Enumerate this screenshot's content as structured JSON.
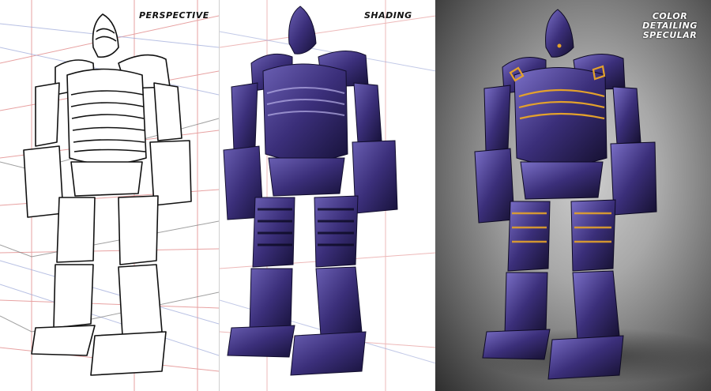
{
  "panels": [
    {
      "id": "perspective",
      "label": "PERSPECTIVE"
    },
    {
      "id": "shading",
      "label": "SHADING"
    },
    {
      "id": "color",
      "label_lines": [
        "COLOR",
        "DETAILING",
        "SPECULAR"
      ]
    }
  ],
  "colors": {
    "perspective_grid_red": "#e28a8a",
    "perspective_grid_blue": "#9aa6d8",
    "robot_purple": "#3b2f7a",
    "robot_purple_dark": "#1d1745",
    "accent_orange": "#e3a12c",
    "background_gray": "#a8a8a8"
  }
}
